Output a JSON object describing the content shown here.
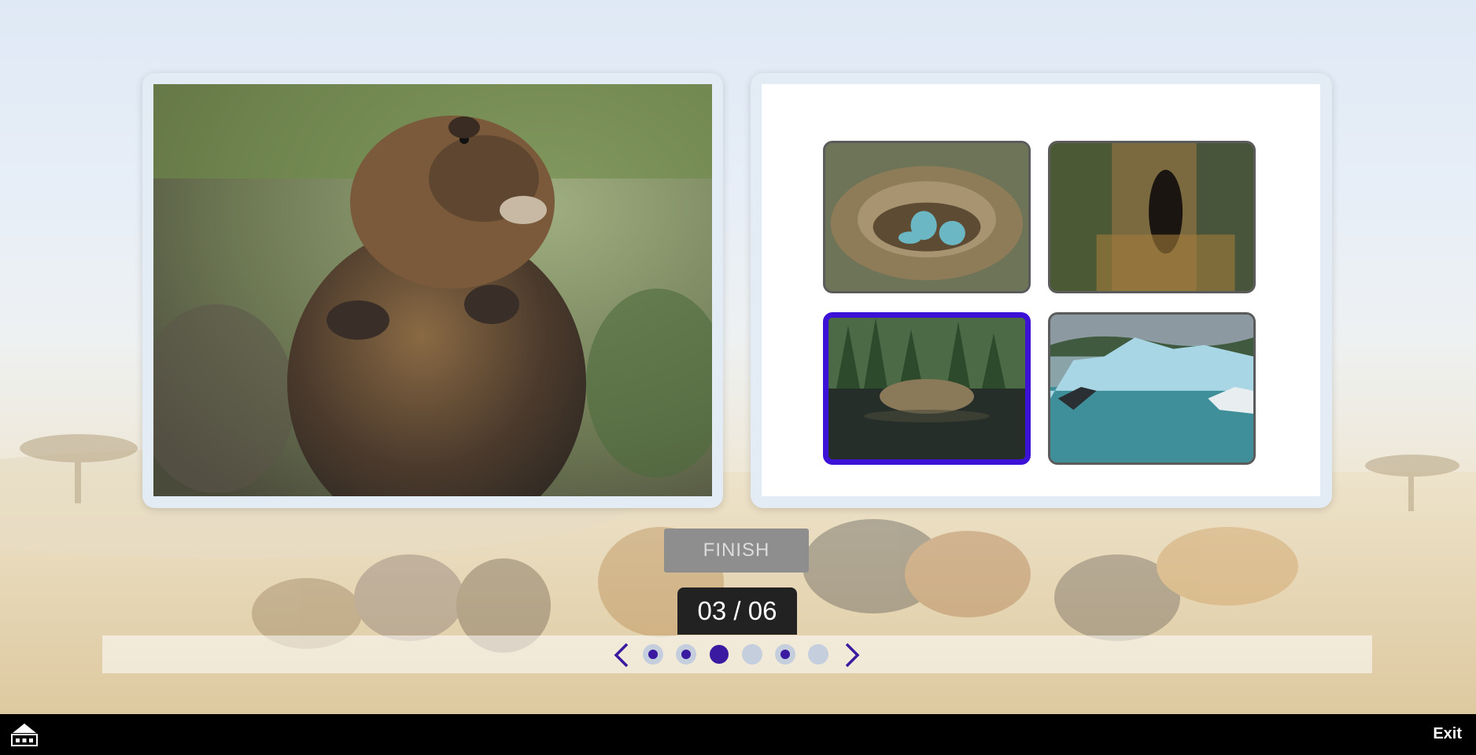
{
  "activity": {
    "finish_label": "FINISH",
    "page_counter": "03 / 06",
    "current_page": 3,
    "total_pages": 6
  },
  "question_image": {
    "icon": "beaver-photo"
  },
  "options": [
    {
      "icon": "bird-nest-photo",
      "selected": false
    },
    {
      "icon": "tree-hollow-photo",
      "selected": false
    },
    {
      "icon": "beaver-lodge-photo",
      "selected": true
    },
    {
      "icon": "icebergs-photo",
      "selected": false
    }
  ],
  "pagination": {
    "dots": [
      {
        "state": "answered"
      },
      {
        "state": "answered"
      },
      {
        "state": "current"
      },
      {
        "state": "empty"
      },
      {
        "state": "answered"
      },
      {
        "state": "empty"
      }
    ]
  },
  "footer": {
    "exit_label": "Exit"
  },
  "colors": {
    "accent": "#3b12d6",
    "dot_filled": "#3a1aa0",
    "dot_empty": "#c4cedd",
    "footer_bg": "#000000"
  }
}
